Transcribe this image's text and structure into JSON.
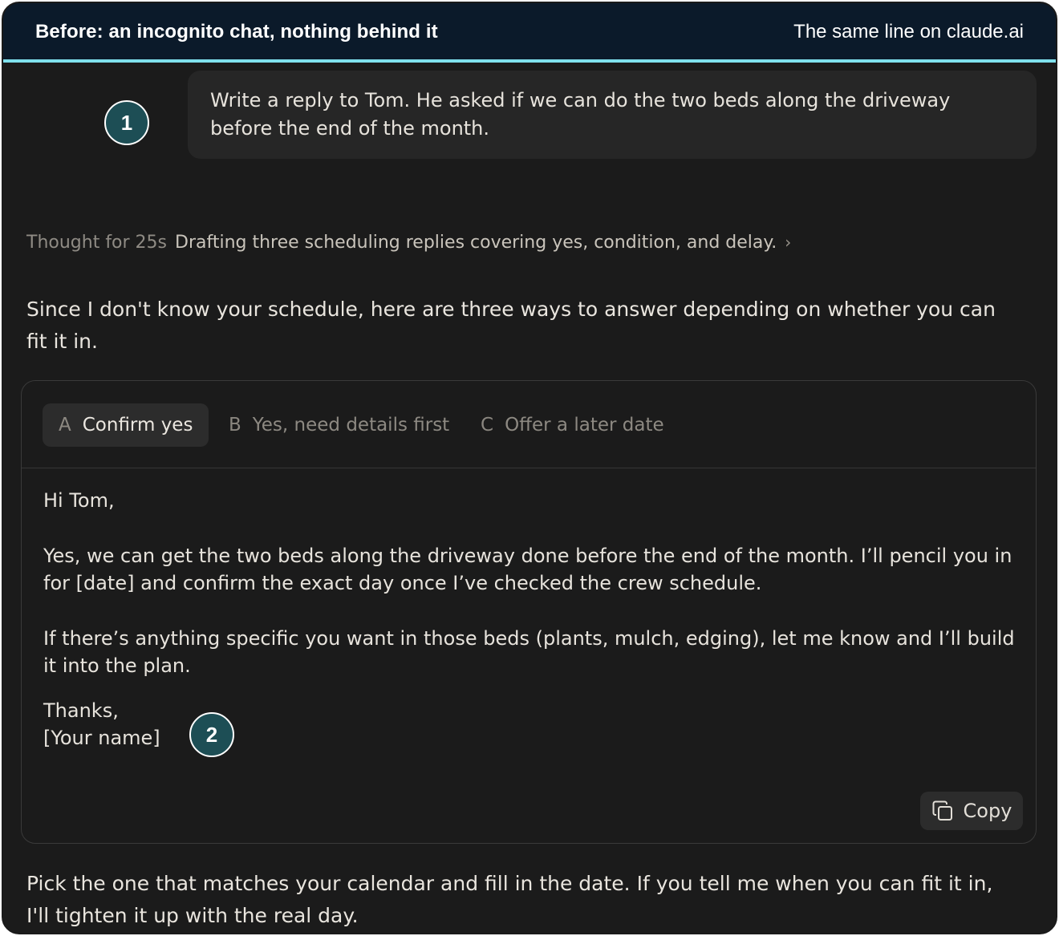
{
  "header": {
    "left_title": "Before: an incognito chat, nothing behind it",
    "right_title": "The same line on claude.ai"
  },
  "user_message": {
    "text": "Write a reply to Tom. He asked if we can do the two beds along the driveway before the end of the month."
  },
  "badges": {
    "one": "1",
    "two": "2"
  },
  "thinking": {
    "label": "Thought for 25s",
    "summary": "Drafting three scheduling replies covering yes, condition, and delay.",
    "chevron_icon": "chevron-right-icon"
  },
  "assistant": {
    "intro": "Since I don't know your schedule, here are three ways to answer depending on whether you can fit it in.",
    "outro": "Pick the one that matches your calendar and fill in the date. If you tell me when you can fit it in, I'll tighten it up with the real day."
  },
  "options_card": {
    "tabs": [
      {
        "letter": "A",
        "label": "Confirm yes",
        "active": true
      },
      {
        "letter": "B",
        "label": "Yes, need details first",
        "active": false
      },
      {
        "letter": "C",
        "label": "Offer a later date",
        "active": false
      }
    ],
    "draft": {
      "greeting": "Hi Tom,",
      "para1": "Yes, we can get the two beds along the driveway done before the end of the month. I’ll pencil you in for [date] and confirm the exact day once I’ve checked the crew schedule.",
      "para2": "If there’s anything specific you want in those beds (plants, mulch, edging), let me know and I’ll build it into the plan.",
      "signoff": "Thanks,",
      "signature": "[Your name]"
    },
    "copy_label": "Copy",
    "copy_icon": "copy-icon"
  },
  "colors": {
    "header_bg": "#0b1a2a",
    "header_rule": "#7fe0ec",
    "canvas_bg": "#1b1b1b",
    "badge_fill": "#1d4e55"
  }
}
